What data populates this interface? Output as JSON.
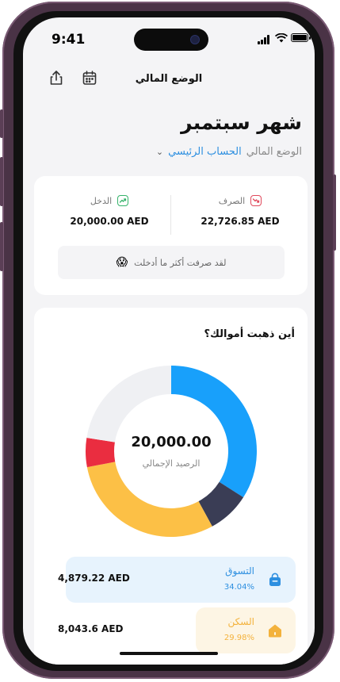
{
  "status_bar": {
    "time": "9:41"
  },
  "header": {
    "title": "الوضع المالي"
  },
  "page": {
    "month_title": "شهر سبتمبر",
    "account_label": "الوضع المالي",
    "account_name": "الحساب الرئيسي"
  },
  "summary": {
    "expense_label": "الصرف",
    "expense_amount": "22,726.85 AED",
    "income_label": "الدخل",
    "income_amount": "20,000.00 AED",
    "alert_text": "لقد صرفت أكثر ما أدخلت",
    "alert_emoji": "😱"
  },
  "spending": {
    "title": "أين ذهبت أموالك؟",
    "total_value": "20,000.00",
    "total_label": "الرصيد الإجمالي",
    "categories": [
      {
        "name": "التسوق",
        "percent": "34.04%",
        "amount": "4,879.22 AED",
        "icon": "bag-icon",
        "color": "#2d8fe0",
        "bg": "#e7f3fd"
      },
      {
        "name": "السكن",
        "percent": "29.98%",
        "amount": "8,043.6 AED",
        "icon": "home-icon",
        "color": "#f3b23c",
        "bg": "#fdf5e4"
      }
    ]
  },
  "chart_data": {
    "type": "pie",
    "title": "أين ذهبت أموالك؟",
    "series": [
      {
        "color": "#18a0fb",
        "value": 34.04
      },
      {
        "color": "#3a3d55",
        "value": 8.0
      },
      {
        "color": "#fcc046",
        "value": 29.98
      },
      {
        "color": "#ea2d40",
        "value": 5.5
      },
      {
        "color": "#eff0f3",
        "value": 22.48
      }
    ]
  }
}
